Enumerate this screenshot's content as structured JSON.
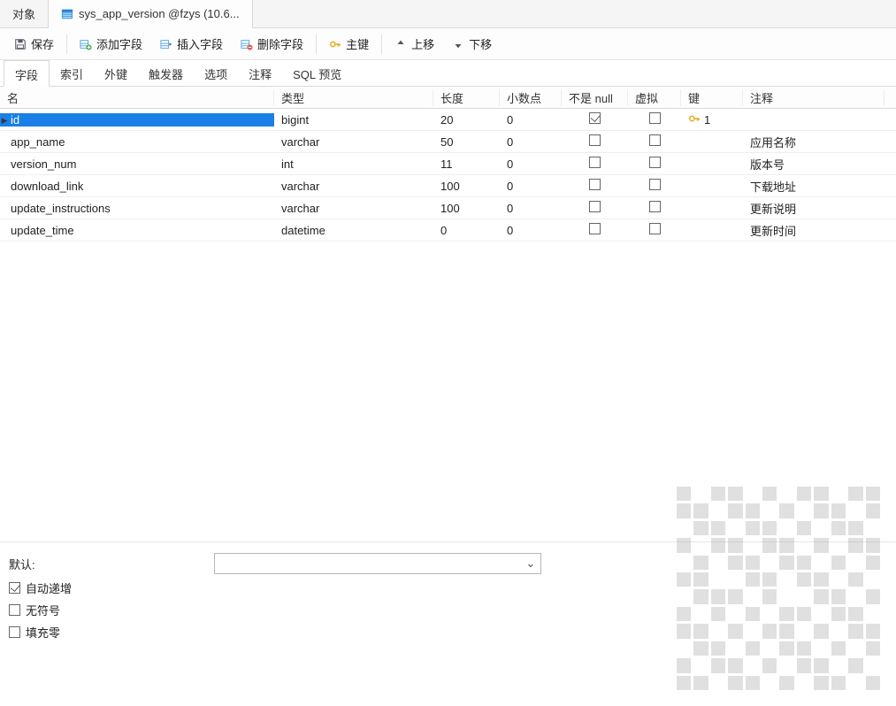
{
  "tabs": {
    "object": "对象",
    "table": "sys_app_version @fzys (10.6..."
  },
  "toolbar": {
    "save": "保存",
    "add_field": "添加字段",
    "insert_field": "插入字段",
    "delete_field": "删除字段",
    "primary_key": "主键",
    "move_up": "上移",
    "move_down": "下移"
  },
  "subtabs": {
    "fields": "字段",
    "indexes": "索引",
    "fk": "外键",
    "triggers": "触发器",
    "options": "选项",
    "comment": "注释",
    "sql_preview": "SQL 预览"
  },
  "columns": {
    "name": "名",
    "type": "类型",
    "length": "长度",
    "decimals": "小数点",
    "not_null": "不是 null",
    "virtual": "虚拟",
    "key": "键",
    "comment": "注释"
  },
  "rows": [
    {
      "name": "id",
      "type": "bigint",
      "length": "20",
      "decimals": "0",
      "not_null": true,
      "virtual": false,
      "key": "1",
      "comment": ""
    },
    {
      "name": "app_name",
      "type": "varchar",
      "length": "50",
      "decimals": "0",
      "not_null": false,
      "virtual": false,
      "key": "",
      "comment": "应用名称"
    },
    {
      "name": "version_num",
      "type": "int",
      "length": "11",
      "decimals": "0",
      "not_null": false,
      "virtual": false,
      "key": "",
      "comment": "版本号"
    },
    {
      "name": "download_link",
      "type": "varchar",
      "length": "100",
      "decimals": "0",
      "not_null": false,
      "virtual": false,
      "key": "",
      "comment": "下载地址"
    },
    {
      "name": "update_instructions",
      "type": "varchar",
      "length": "100",
      "decimals": "0",
      "not_null": false,
      "virtual": false,
      "key": "",
      "comment": "更新说明"
    },
    {
      "name": "update_time",
      "type": "datetime",
      "length": "0",
      "decimals": "0",
      "not_null": false,
      "virtual": false,
      "key": "",
      "comment": "更新时间"
    }
  ],
  "bottom": {
    "default_label": "默认:",
    "auto_increment": "自动递增",
    "auto_increment_checked": true,
    "unsigned": "无符号",
    "unsigned_checked": false,
    "zerofill": "填充零",
    "zerofill_checked": false
  }
}
